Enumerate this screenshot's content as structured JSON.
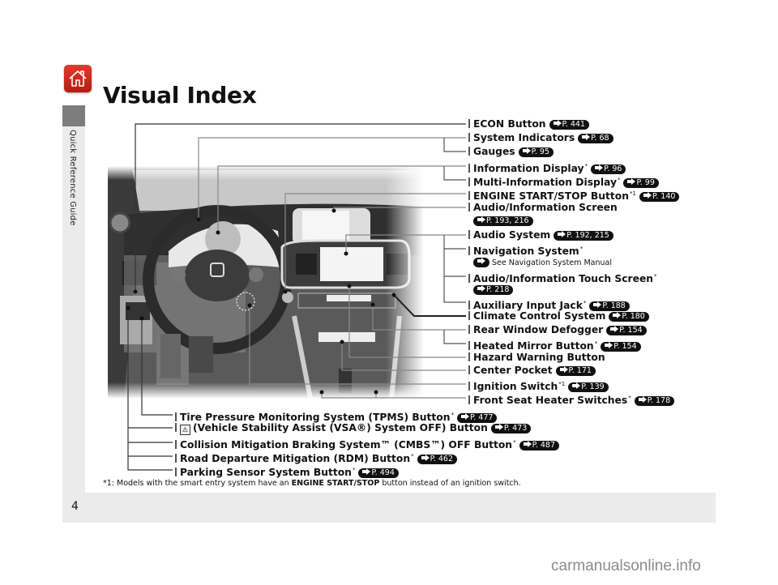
{
  "sidebar": {
    "section_label": "Quick Reference Guide"
  },
  "page": {
    "title": "Visual Index",
    "number": "4"
  },
  "ref_prefix": "P.",
  "callouts_right": [
    {
      "id": "econ",
      "label": "ECON Button",
      "asterisk": "",
      "ref": "441"
    },
    {
      "id": "system-indicators",
      "label": "System Indicators",
      "asterisk": "",
      "ref": "68"
    },
    {
      "id": "gauges",
      "label": "Gauges",
      "asterisk": "",
      "ref": "95"
    },
    {
      "id": "information-display",
      "label": "Information Display",
      "asterisk": "*",
      "ref": "96"
    },
    {
      "id": "multi-information-display",
      "label": "Multi-Information Display",
      "asterisk": "*",
      "ref": "99"
    },
    {
      "id": "engine-start-stop",
      "label": "ENGINE START/STOP Button",
      "asterisk": "*1",
      "ref": "140"
    },
    {
      "id": "audio-information-screen",
      "label": "Audio/Information Screen",
      "asterisk": "",
      "ref": "193, 216",
      "ref_on_next_line": true
    },
    {
      "id": "audio-system",
      "label": "Audio System",
      "asterisk": "",
      "ref": "192, 215"
    },
    {
      "id": "navigation-system",
      "label": "Navigation System",
      "asterisk": "*",
      "ref": "",
      "note": "See Navigation System Manual"
    },
    {
      "id": "audio-information-touch-screen",
      "label": "Audio/Information Touch Screen",
      "asterisk": "*",
      "ref": "218",
      "ref_on_next_line": true
    },
    {
      "id": "auxiliary-input-jack",
      "label": "Auxiliary Input Jack",
      "asterisk": "*",
      "ref": "188"
    },
    {
      "id": "climate-control-system",
      "label": "Climate Control System",
      "asterisk": "",
      "ref": "180"
    },
    {
      "id": "rear-window-defogger",
      "label": "Rear Window Defogger",
      "asterisk": "",
      "ref": "154"
    },
    {
      "id": "heated-mirror-button",
      "label": "Heated Mirror Button",
      "asterisk": "*",
      "ref": "154"
    },
    {
      "id": "hazard-warning-button",
      "label": "Hazard Warning Button",
      "asterisk": "",
      "ref": ""
    },
    {
      "id": "center-pocket",
      "label": "Center Pocket",
      "asterisk": "",
      "ref": "171"
    },
    {
      "id": "ignition-switch",
      "label": "Ignition Switch",
      "asterisk": "*1",
      "ref": "139"
    },
    {
      "id": "front-seat-heater-switches",
      "label": "Front Seat Heater Switches",
      "asterisk": "*",
      "ref": "178"
    }
  ],
  "callouts_bottom": [
    {
      "id": "tpms-button",
      "label": "Tire Pressure Monitoring System (TPMS) Button",
      "asterisk": "*",
      "ref": "477"
    },
    {
      "id": "vsa-off-button",
      "label": "(Vehicle Stability Assist (VSA®) System OFF) Button",
      "asterisk": "",
      "ref": "473",
      "icon": "vsa-off-icon"
    },
    {
      "id": "cmbs-off-button",
      "label": "Collision Mitigation Braking System™ (CMBS™) OFF Button",
      "asterisk": "*",
      "ref": "487"
    },
    {
      "id": "rdm-button",
      "label": "Road Departure Mitigation (RDM) Button",
      "asterisk": "*",
      "ref": "462"
    },
    {
      "id": "parking-sensor-button",
      "label": "Parking Sensor System Button",
      "asterisk": "*",
      "ref": "494"
    }
  ],
  "footnote": {
    "prefix": "*1: Models with the smart entry system have an ",
    "bold": "ENGINE START/STOP",
    "suffix": " button instead of an ignition switch."
  },
  "watermark": "carmanualsonline.info",
  "colors": {
    "home_icon": "#d42a1f",
    "sidebar_tab": "#7d7d7d",
    "sidebar_bg": "#ebebeb"
  }
}
